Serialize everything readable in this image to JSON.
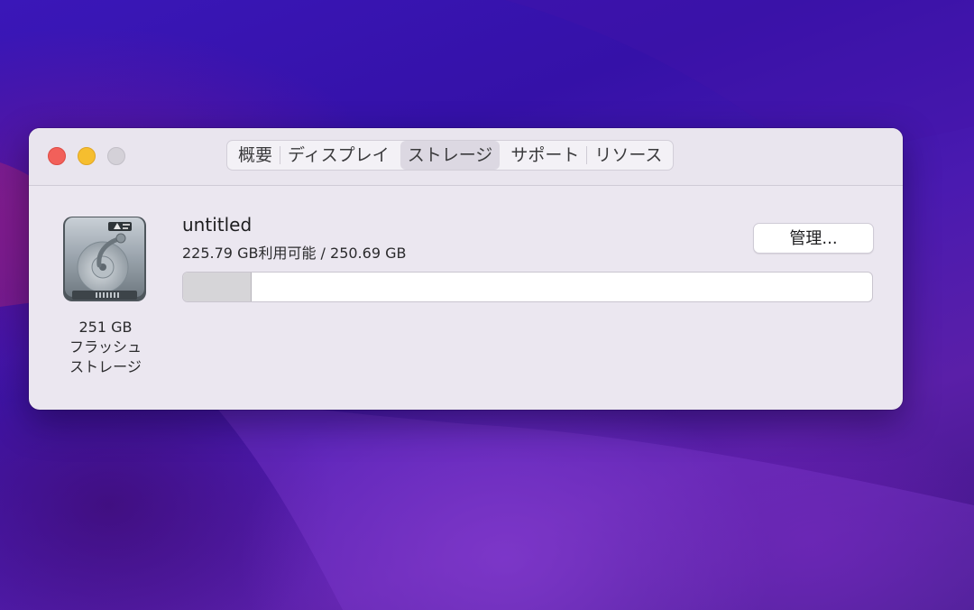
{
  "window": {
    "tabs": [
      {
        "label": "概要",
        "active": false
      },
      {
        "label": "ディスプレイ",
        "active": false
      },
      {
        "label": "ストレージ",
        "active": true
      },
      {
        "label": "サポート",
        "active": false
      },
      {
        "label": "リソース",
        "active": false
      }
    ]
  },
  "storage": {
    "drive": {
      "capacity": "251 GB",
      "type_line1": "フラッシュ",
      "type_line2": "ストレージ",
      "icon": "hard-drive-icon"
    },
    "volume_name": "untitled",
    "usage_text": "225.79 GB利用可能 / 250.69 GB",
    "used_fraction": 0.1,
    "manage_label": "管理..."
  },
  "colors": {
    "close": "#f2605a",
    "minimize": "#f6be2f",
    "zoom": "#d4d1d8",
    "used_segment": "#d6d5d8"
  }
}
